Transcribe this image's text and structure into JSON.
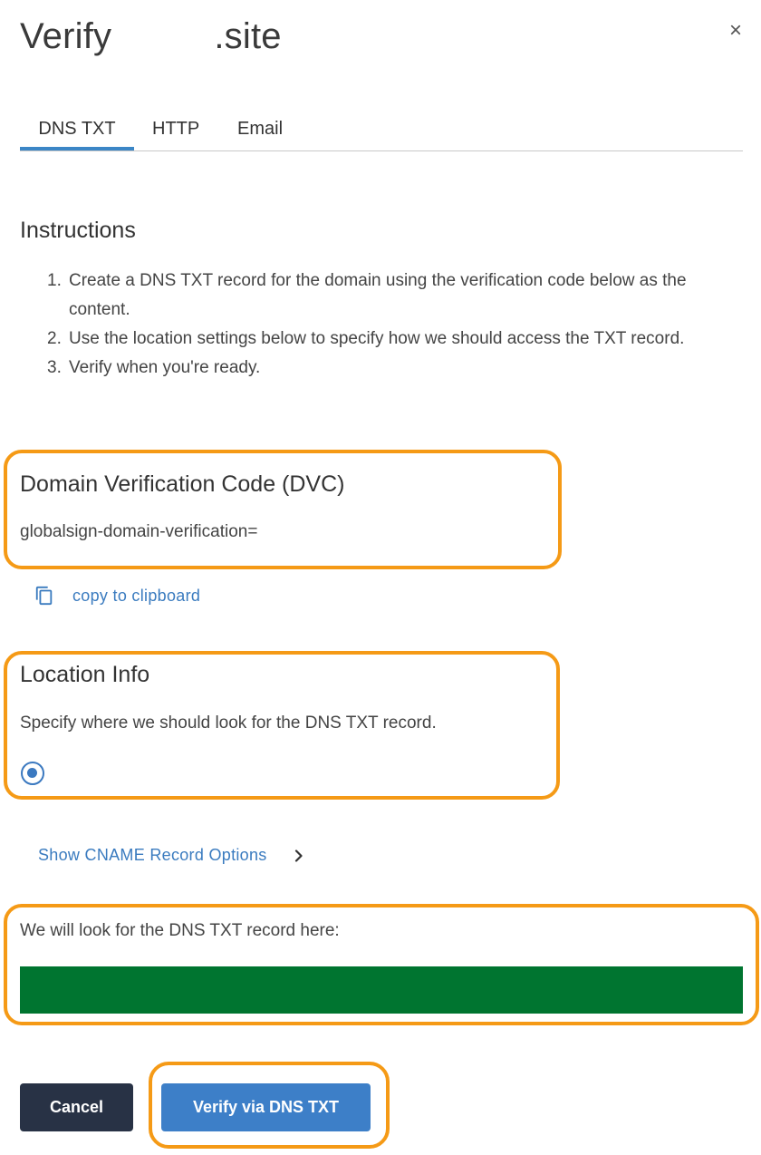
{
  "dialog": {
    "title": "Verify          .site",
    "close_symbol": "×"
  },
  "tabs": [
    {
      "label": "DNS TXT",
      "active": true
    },
    {
      "label": "HTTP",
      "active": false
    },
    {
      "label": "Email",
      "active": false
    }
  ],
  "instructions": {
    "heading": "Instructions",
    "steps": [
      {
        "num": "1.",
        "text": "Create a DNS TXT record for the domain using the verification code below as the content."
      },
      {
        "num": "2.",
        "text": "Use the location settings below to specify how we should access the TXT record."
      },
      {
        "num": "3.",
        "text": "Verify when you're ready."
      }
    ]
  },
  "dvc": {
    "heading": "Domain Verification Code (DVC)",
    "code": "globalsign-domain-verification=",
    "copy_label": "copy to clipboard",
    "copy_icon": "copy-icon"
  },
  "location": {
    "heading": "Location Info",
    "description": "Specify where we should look for the DNS TXT record.",
    "radio_selected": true
  },
  "cname": {
    "label": "Show CNAME Record Options",
    "icon": "chevron-right-icon"
  },
  "lookup": {
    "label": "We will look for the DNS TXT record here:",
    "box_color": "#007530"
  },
  "buttons": {
    "cancel": "Cancel",
    "verify": "Verify via DNS TXT"
  },
  "colors": {
    "accent": "#3b86c6",
    "highlight": "#f59a16",
    "cancel_bg": "#283245",
    "verify_bg": "#3d7fc8"
  }
}
